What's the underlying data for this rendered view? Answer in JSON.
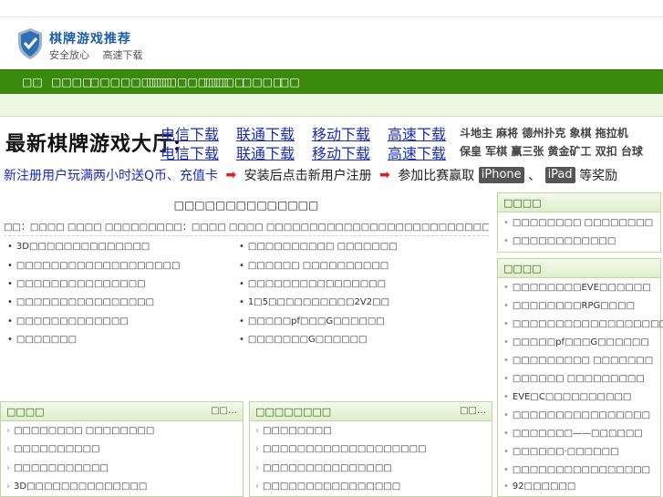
{
  "logo": {
    "icon": "shield-check-icon",
    "title": "棋牌游戏推荐",
    "slogan": "安全放心　 高速下载"
  },
  "nav": [
    "□□",
    "□□□□",
    "□□□□□□□□",
    "□□□□□□□□",
    "□□□□",
    "□□□□",
    "□□"
  ],
  "banner": {
    "title": "最新棋牌游戏大厅:",
    "links_row1": [
      "电信下载",
      "联通下载",
      "移动下载",
      "高速下载"
    ],
    "links_row2": [
      "电信下载",
      "联通下载",
      "移动下载",
      "高速下载"
    ],
    "games_row1": "斗地主 麻将 德州扑克 象棋 拖拉机",
    "games_row2": "保皇 军棋 赢三张 黄金矿工 双扣 台球",
    "promo": {
      "part1": "新注册用户玩满两小时送Q币、充值卡",
      "part2": "安装后点击新用户注册",
      "part3": "参加比赛赢取",
      "pill1": "iPhone",
      "sep": "、",
      "pill2": "iPad",
      "part4": "等奖励"
    }
  },
  "main": {
    "title": "□□□□□□□□□□□□□□",
    "summary": "□□：□□□□ □□□□ □□□□□□□□□：□□□□ □□□□ □□□□□□□□□□□□□□□□□□□□□□□□□□□□□□□□□□□□□□□□□□□□□□□□□□□…",
    "more": "[□□□□]",
    "left_items": [
      "3D□□□□□□□□□□□□□□",
      "□□□□□□□□□□□□□□□□□□□",
      "□□□□□□□□□□□□□□□",
      "□□□□□□□□□□□□□□□□",
      "□□□□□□□□□□□□□",
      "□□□□□□□"
    ],
    "right_items": [
      "□□□□□□□□□□ □□□□□□□",
      "□□□□□□ □□□□□□□□□□",
      "□□□□□□□□□□□□□□□□",
      "1□5□□□□□□□□□□2V2□□",
      "□□□□□pf□□□G□□□□□□",
      "□□□□□□□G□□□□□□"
    ]
  },
  "panels": {
    "top": {
      "title": "□□□□",
      "items": [
        "□□□□□□□□ □□□□□□□□",
        "□□□□□□□□□□□□"
      ]
    },
    "list": {
      "title": "□□□□",
      "items": [
        "□□□□□□□□EVE□□□□□□",
        "□□□□□□□□RPG□□□□",
        "□□□□□□□□□□□□□□□□□□□",
        "□□□□□pf□□□G□□□□□□",
        "□□□□□□□□□ □□□□□□□",
        "□□□□□□ □□□□□□□□□",
        "EVE□C□□□□□□□□□□",
        "□□□□□□□□□□□□□□□□",
        "□□□□□□□——□□□□□□",
        "□□□□□□·□□□□□□",
        "□□□□□□□□□□□□□□□□",
        "92□□□□□□"
      ]
    },
    "bottom_left": {
      "title": "□□□□",
      "more": "□□…",
      "items": [
        "□□□□□□□□ □□□□□□□□",
        "□□□□□□□□□□",
        "□□□□□□□□□□□",
        "3D□□□□□□□□□□□□□□"
      ]
    },
    "bottom_mid": {
      "title": "□□□□□□□□",
      "more": "□□…",
      "items": [
        "□□□□□□□□",
        "□□□□□□□□□□□□□□□□□□□",
        "□□□□□□□□□□□□□□□",
        "□□□□□□□□□□□□□□□□"
      ]
    }
  }
}
